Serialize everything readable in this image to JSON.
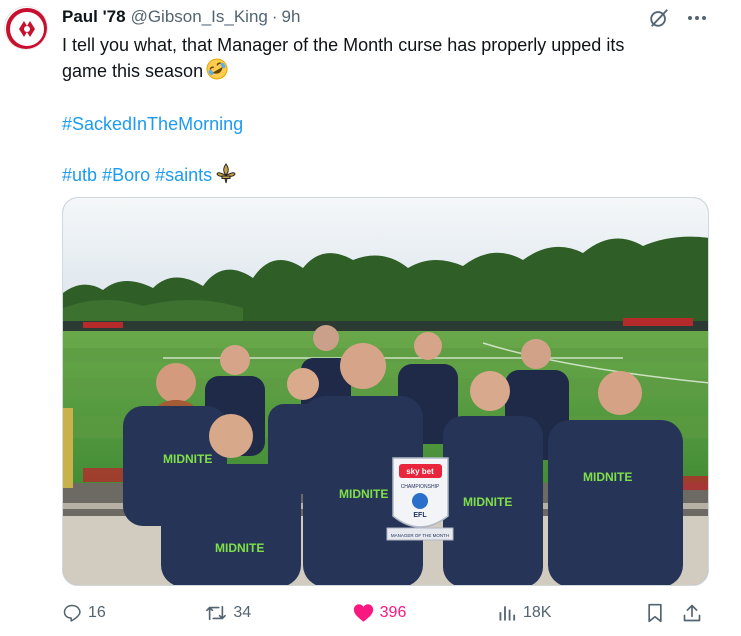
{
  "tweet": {
    "author_name": "Paul '78",
    "handle": "@Gibson_Is_King",
    "separator": "·",
    "time": "9h",
    "text_line1": "I tell you what, that Manager of the Month curse has properly upped its",
    "text_line2": "game this season",
    "emoji": "rolling-on-floor-laughing",
    "hashtag_sacked": "#SackedInTheMorning",
    "hashtag_utb": "#utb",
    "hashtag_boro": "#Boro",
    "hashtag_saints": "#saints",
    "hashtag_saints_emoji": "fleur-de-lis"
  },
  "media": {
    "description_icon": "team-photo",
    "trophy_brand": "sky bet",
    "trophy_title": "CHAMPIONSHIP",
    "trophy_league": "EFL",
    "trophy_caption": "MANAGER OF THE MONTH",
    "shirt_sponsor": "MIDNITE"
  },
  "actions": {
    "replies": "16",
    "reposts": "34",
    "likes": "396",
    "views": "18K"
  },
  "colors": {
    "accent": "#1d9bf0",
    "like": "#f91880",
    "muted": "#536471",
    "text": "#0f1419"
  }
}
